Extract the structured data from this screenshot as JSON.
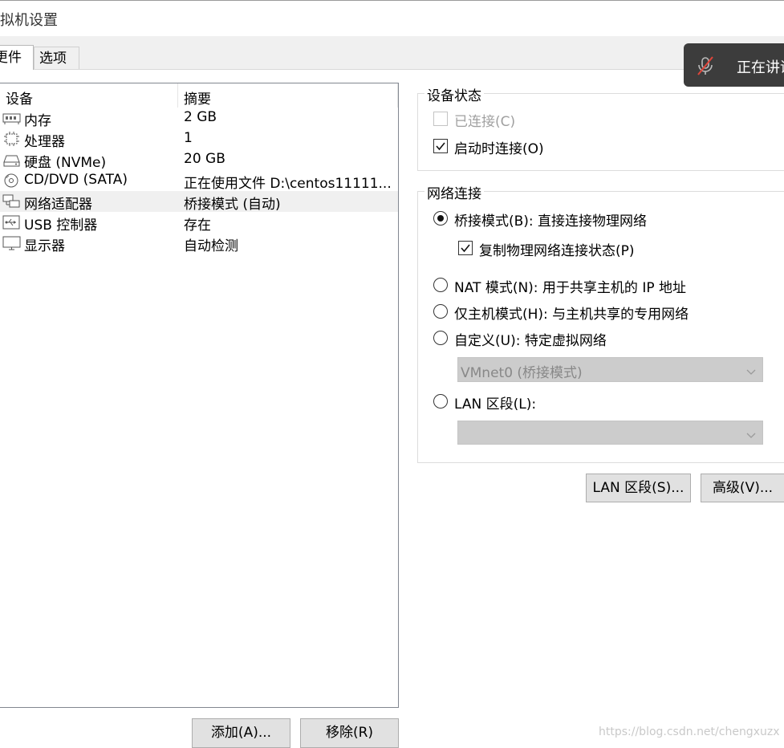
{
  "window": {
    "title": "拟机设置"
  },
  "tabs": [
    {
      "label": "硬件",
      "display": "更件",
      "active": true
    },
    {
      "label": "选项",
      "active": false
    }
  ],
  "device_list": {
    "headers": {
      "device": "设备",
      "summary": "摘要"
    },
    "rows": [
      {
        "icon": "memory-icon",
        "name": "内存",
        "summary": "2 GB",
        "selected": false
      },
      {
        "icon": "processor-icon",
        "name": "处理器",
        "summary": "1",
        "selected": false
      },
      {
        "icon": "hard-disk-icon",
        "name": "硬盘 (NVMe)",
        "summary": "20 GB",
        "selected": false
      },
      {
        "icon": "cd-dvd-icon",
        "name": "CD/DVD (SATA)",
        "summary": "正在使用文件 D:\\centos11111...",
        "selected": false
      },
      {
        "icon": "network-adapter-icon",
        "name": "网络适配器",
        "summary": "桥接模式 (自动)",
        "selected": true
      },
      {
        "icon": "usb-icon",
        "name": "USB 控制器",
        "summary": "存在",
        "selected": false
      },
      {
        "icon": "display-icon",
        "name": "显示器",
        "summary": "自动检测",
        "selected": false
      }
    ]
  },
  "buttons": {
    "add": "添加(A)...",
    "remove": "移除(R)",
    "lan_segments": "LAN 区段(S)...",
    "advanced": "高级(V)..."
  },
  "device_status": {
    "legend": "设备状态",
    "connected": {
      "label": "已连接(C)",
      "checked": false,
      "disabled": true
    },
    "connect_at_power_on": {
      "label": "启动时连接(O)",
      "checked": true
    }
  },
  "network_connection": {
    "legend": "网络连接",
    "bridged": {
      "label": "桥接模式(B): 直接连接物理网络",
      "selected": true
    },
    "replicate": {
      "label": "复制物理网络连接状态(P)",
      "checked": true
    },
    "nat": {
      "label": "NAT 模式(N): 用于共享主机的 IP 地址",
      "selected": false
    },
    "host_only": {
      "label": "仅主机模式(H): 与主机共享的专用网络",
      "selected": false
    },
    "custom": {
      "label": "自定义(U): 特定虚拟网络",
      "selected": false,
      "select_value": "VMnet0 (桥接模式)"
    },
    "lan_segment": {
      "label": "LAN 区段(L):",
      "selected": false,
      "select_value": ""
    }
  },
  "notification": {
    "text": "正在讲话"
  },
  "watermark": "https://blog.csdn.net/chengxuzx",
  "colors": {
    "selected_row": "#f0f0f0",
    "button_bg": "#e1e1e1",
    "toast_bg": "#3c3c3c",
    "disabled_combo": "#cccccc"
  }
}
